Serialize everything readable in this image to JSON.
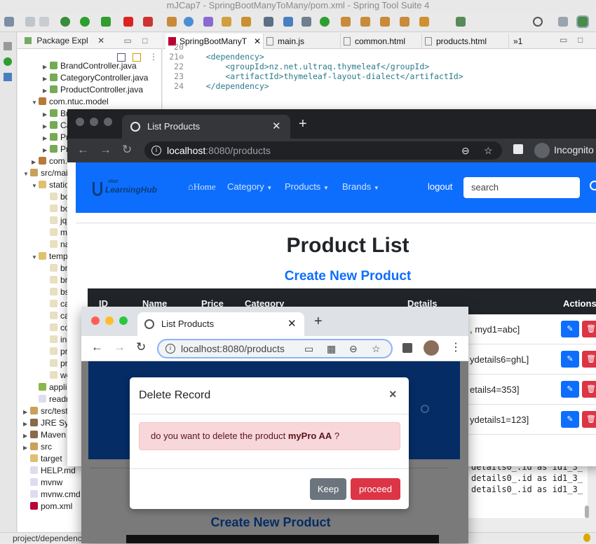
{
  "ide": {
    "title": "mJCap7 - SpringBootManyToMany/pom.xml - Spring Tool Suite 4",
    "package_explorer_tab": "Package Expl",
    "tree": [
      {
        "label": "BrandController.java"
      },
      {
        "label": "CategoryController.java"
      },
      {
        "label": "ProductController.java"
      },
      {
        "label": "com.ntuc.model"
      },
      {
        "label": "Br"
      },
      {
        "label": "Ca"
      },
      {
        "label": "Pr"
      },
      {
        "label": "Pr"
      },
      {
        "label": "com.n"
      },
      {
        "label": "src/main"
      },
      {
        "label": "static"
      },
      {
        "label": "bo"
      },
      {
        "label": "bo"
      },
      {
        "label": "jqu"
      },
      {
        "label": "ma"
      },
      {
        "label": "na"
      },
      {
        "label": "temp"
      },
      {
        "label": "br"
      },
      {
        "label": "br"
      },
      {
        "label": "bs"
      },
      {
        "label": "ca"
      },
      {
        "label": "ca"
      },
      {
        "label": "co"
      },
      {
        "label": "ind"
      },
      {
        "label": "pr"
      },
      {
        "label": "pr"
      },
      {
        "label": "we"
      },
      {
        "label": "applic"
      },
      {
        "label": "readm"
      },
      {
        "label": "src/test/"
      },
      {
        "label": "JRE Syst"
      },
      {
        "label": "Maven D"
      },
      {
        "label": "src"
      },
      {
        "label": "target"
      },
      {
        "label": "HELP.md"
      },
      {
        "label": "mvnw"
      },
      {
        "label": "mvnw.cmd"
      },
      {
        "label": "pom.xml"
      }
    ],
    "editor_tabs": [
      "SpringBootManyT",
      "main.js",
      "common.html",
      "products.html",
      "»1"
    ],
    "code": [
      {
        "num": "20",
        "text": ""
      },
      {
        "num": "21⊖",
        "text": "    <dependency>"
      },
      {
        "num": "22",
        "text": "        <groupId>nz.net.ultraq.thymeleaf</groupId>"
      },
      {
        "num": "23",
        "text": "        <artifactId>thymeleaf-layout-dialect</artifactId>"
      },
      {
        "num": "24",
        "text": "    </dependency>"
      }
    ],
    "console_lines": [
      "details0_.id as id1_3_",
      "details0_.id as id1_3_",
      "details0_.id as id1_3_"
    ],
    "status": "project/dependenc"
  },
  "browser1": {
    "tab_title": "List Products",
    "url_host": "localhost",
    "url_rest": ":8080/products",
    "incognito": "Incognito",
    "brand_top": "ntuc",
    "brand_main": "LearningHub",
    "nav": {
      "home": "Home",
      "category": "Category",
      "products": "Products",
      "brands": "Brands",
      "logout": "logout",
      "search_placeholder": "search"
    },
    "page_title": "Product List",
    "create_link": "Create New Product",
    "columns": [
      "ID",
      "Name",
      "Price",
      "Category",
      "Details",
      "Actions"
    ],
    "rows": [
      {
        "details": ", myd1=abc]"
      },
      {
        "details": "ydetails6=ghL]"
      },
      {
        "details": "etails4=353]"
      },
      {
        "details": "ydetails1=123]"
      }
    ]
  },
  "browser2": {
    "tab_title": "List Products",
    "url": "localhost:8080/products",
    "create_link": "Create New Product",
    "modal": {
      "title": "Delete Record",
      "close": "×",
      "message_prefix": "do you want to delete the product ",
      "product_name": "myPro AA",
      "message_suffix": " ?",
      "keep_label": "Keep",
      "proceed_label": "proceed"
    }
  },
  "colors": {
    "primary": "#0d6efd",
    "danger": "#dc3545",
    "secondary": "#6c757d",
    "dark": "#212529"
  }
}
